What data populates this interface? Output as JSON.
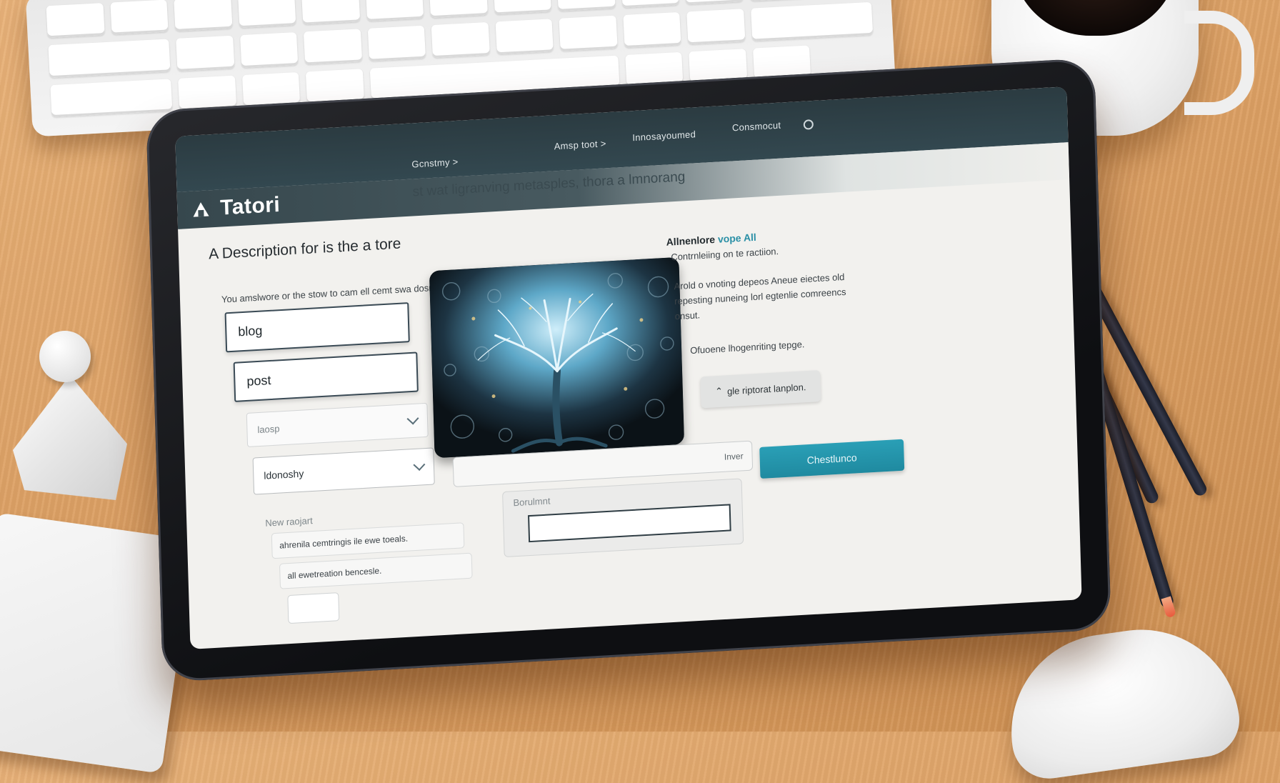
{
  "top_nav": {
    "links": [
      "Gcnstmy >",
      "Amsp toot >",
      "Innosayoumed",
      "Consmocut"
    ]
  },
  "app": {
    "title": "Tatori",
    "subtitle": "st wat ligranving metasples, thora a lmnorang"
  },
  "main": {
    "heading": "A Description for is the a tore",
    "intro": "You amslwore or the stow to cam ell cemt swa dosrie.",
    "fields": [
      {
        "value": "blog"
      },
      {
        "value": "post"
      }
    ],
    "select_1": {
      "value": "laosp"
    },
    "select_2": {
      "value": "ldonoshy"
    },
    "new_label": "New raojart",
    "rows": [
      "ahrenila cemtringis ile ewe toeals.",
      "all ewetreation bencesle."
    ]
  },
  "side": {
    "title": "Allnenlore",
    "title_link": "vope All",
    "subtitle": "Contrnleiing on te ractiion.",
    "body": "Arold o vnoting depeos Aneue eiectes old repesting nuneing lorl egtenlie comreencs onsut.",
    "note": "Ofuoene lhogenriting tepge.",
    "button_label": "gle riptorat lanplon."
  },
  "form": {
    "wide_field_hint": "Inver",
    "cta_label": "Chestlunco",
    "sub_panel_label": "Borulmnt",
    "sub_panel_input_value": ""
  },
  "icons": {
    "logo": "tatori-logo-icon",
    "chevron": "chevron-down-icon",
    "nav": "settings-icon",
    "upload": "upload-icon"
  },
  "colors": {
    "nav_bg": "#2b3b41",
    "accent": "#2b90a6",
    "cta": "#1f8aa0"
  }
}
